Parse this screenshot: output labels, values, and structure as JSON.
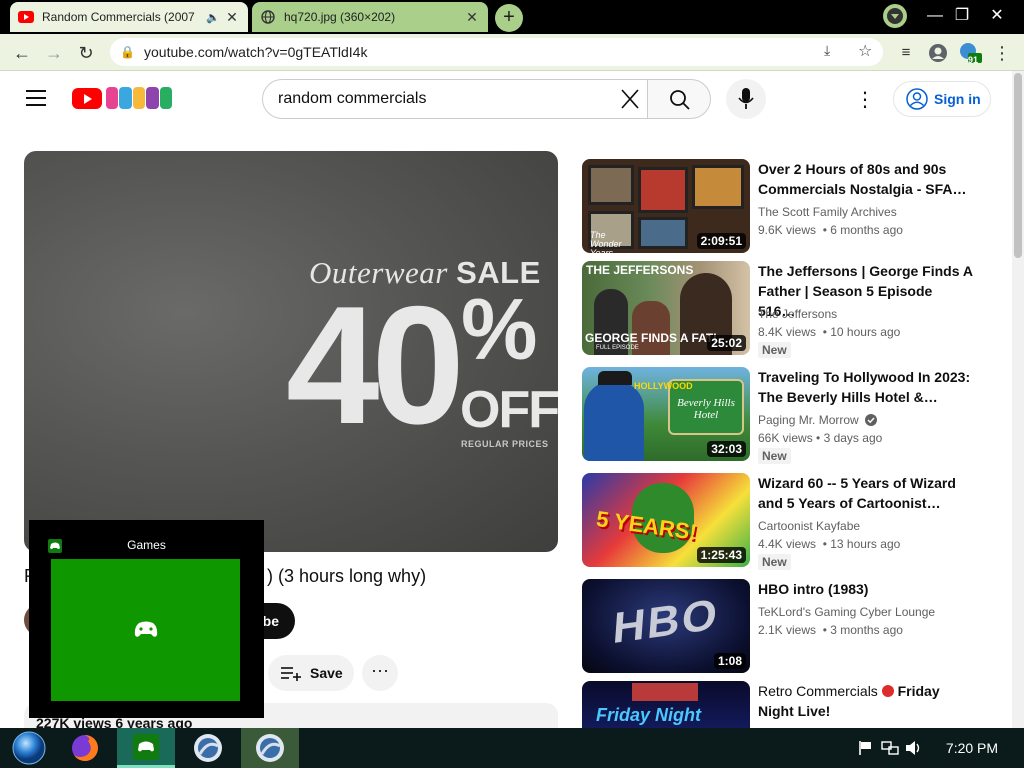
{
  "browser": {
    "tabs": [
      {
        "title": "Random Commercials (2007",
        "active": true
      },
      {
        "title": "hq720.jpg (360×202)",
        "active": false
      }
    ],
    "url": "youtube.com/watch?v=0gTEATldI4k",
    "extension_badge": "91"
  },
  "header": {
    "search_value": "random commercials",
    "signin_label": "Sign in"
  },
  "player": {
    "ad_line1_italic": "Outerwear ",
    "ad_line1_bold": "SALE",
    "ad_big": "40",
    "ad_pct": "%",
    "ad_off": "OFF",
    "ad_regular": "REGULAR PRICES"
  },
  "video": {
    "title_visible": "R",
    "title_tail": ") (3 hours long why)",
    "subscribe_label": "be",
    "save_label": "Save",
    "views_line": "227K views  6 years ago"
  },
  "gamebar": {
    "title": "Games"
  },
  "recommendations": [
    {
      "title": "Over 2 Hours of 80s and 90s Commercials Nostalgia - SFA…",
      "channel": "The Scott Family Archives",
      "views": "9.6K views",
      "age": "6 months ago",
      "duration": "2:09:51",
      "badge": "",
      "verified": false
    },
    {
      "title": "The Jeffersons | George Finds A Father | Season 5 Episode 516…",
      "channel": "The Jeffersons",
      "views": "8.4K views",
      "age": "10 hours ago",
      "duration": "25:02",
      "badge": "New",
      "verified": false
    },
    {
      "title": "Traveling To Hollywood In 2023: The Beverly Hills Hotel &…",
      "channel": "Paging Mr. Morrow",
      "views": "66K views",
      "age": "3 days ago",
      "duration": "32:03",
      "badge": "New",
      "verified": true
    },
    {
      "title": "Wizard 60 -- 5 Years of Wizard and 5 Years of Cartoonist…",
      "channel": "Cartoonist Kayfabe",
      "views": "4.4K views",
      "age": "13 hours ago",
      "duration": "1:25:43",
      "badge": "New",
      "verified": false
    },
    {
      "title": "HBO intro (1983)",
      "channel": "TeKLord's Gaming Cyber Lounge",
      "views": "2.1K views",
      "age": "3 months ago",
      "duration": "1:08",
      "badge": "",
      "verified": false
    },
    {
      "title": "Retro Commercials",
      "title_tail": " Friday Night Live!",
      "channel": "",
      "views": "",
      "age": "",
      "duration": "",
      "badge": "",
      "verified": false
    }
  ],
  "thumb_text": {
    "jeffersons_top": "THE JEFFERSONS",
    "jeffersons_bottom": "GEORGE FINDS A FATI",
    "jeffersons_full": "FULL EPISODE",
    "hollywood": "HOLLYWOOD",
    "beverly": "Beverly Hills Hotel",
    "wizard": "5 YEARS!",
    "hbo": "HBO",
    "friday": "Friday Night",
    "wonder": "The Wonder Years"
  },
  "taskbar": {
    "clock": "7:20 PM"
  },
  "colors": {
    "youtube_red": "#ff0000",
    "link_blue": "#065fd4",
    "xbox_green": "#0f9700",
    "chrome_green": "#ecf3e0"
  }
}
